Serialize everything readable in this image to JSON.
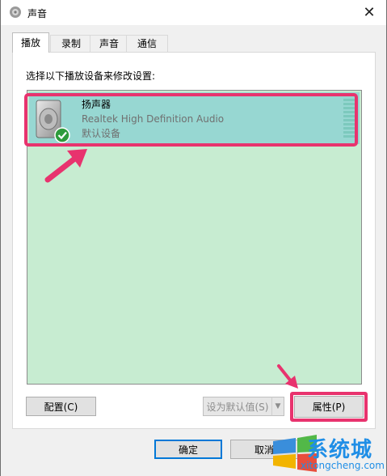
{
  "window": {
    "title": "声音",
    "close_glyph": "✕"
  },
  "tabs": [
    {
      "label": "播放",
      "active": true
    },
    {
      "label": "录制",
      "active": false
    },
    {
      "label": "声音",
      "active": false
    },
    {
      "label": "通信",
      "active": false
    }
  ],
  "instruction": "选择以下播放设备来修改设置:",
  "device": {
    "name": "扬声器",
    "description": "Realtek High Definition Audio",
    "status": "默认设备",
    "icon": "speaker-icon",
    "badge": "check-icon"
  },
  "buttons": {
    "configure": "配置(C)",
    "set_default": "设为默认值(S)",
    "properties": "属性(P)",
    "ok": "确定",
    "cancel": "取消"
  },
  "watermark": {
    "text": "系统城",
    "sub": "xitongcheng.com"
  },
  "colors": {
    "highlight": "#e8336e",
    "list_bg": "#c7ecd1",
    "selected_bg": "#97d7d2",
    "accent": "#0078d7"
  }
}
